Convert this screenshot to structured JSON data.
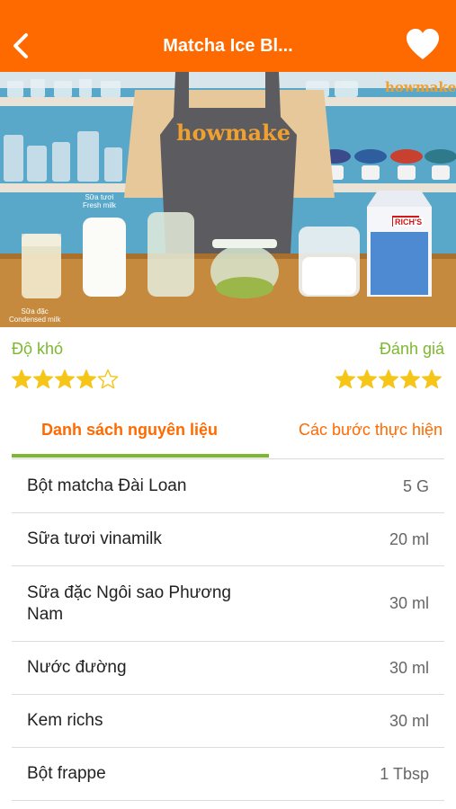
{
  "header": {
    "title": "Matcha Ice Bl...",
    "back_icon": "chevron-left-icon",
    "favorite_icon": "heart-icon",
    "color": "#ff6a00"
  },
  "hero_image": {
    "logo_text": "howmake",
    "captions": {
      "fresh_milk": "Sữa tươi\nFresh milk",
      "condensed_milk": "Sữa đặc\nCondensed milk"
    },
    "carton_brand": "RICH'S"
  },
  "ratings": {
    "difficulty_label": "Độ khó",
    "difficulty_stars": 4,
    "rating_label": "Đánh giá",
    "rating_stars": 5,
    "star_color": "#f5c518"
  },
  "tabs": {
    "ingredients": "Danh sách nguyên liệu",
    "steps": "Các bước thực hiện",
    "active": "ingredients",
    "accent": "#7cb82f"
  },
  "ingredients": [
    {
      "name": "Bột matcha Đài Loan",
      "qty": "5 G"
    },
    {
      "name": "Sữa tươi vinamilk",
      "qty": "20 ml"
    },
    {
      "name": "Sữa đặc Ngôi sao Phương Nam",
      "qty": "30 ml"
    },
    {
      "name": "Nước đường",
      "qty": "30 ml"
    },
    {
      "name": "Kem richs",
      "qty": "30 ml"
    },
    {
      "name": "Bột frappe",
      "qty": "1 Tbsp"
    }
  ]
}
